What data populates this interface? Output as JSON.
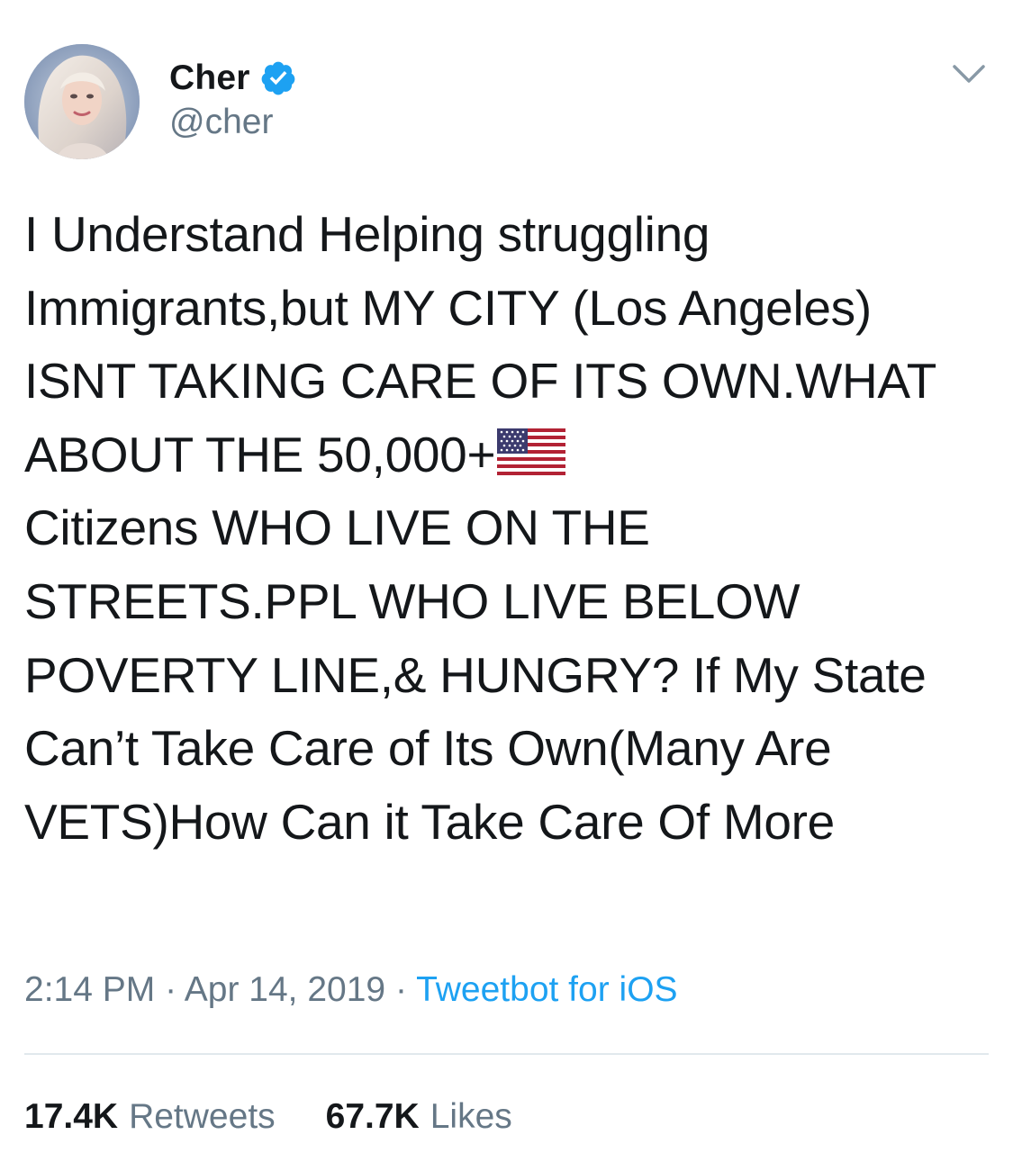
{
  "author": {
    "display_name": "Cher",
    "handle": "@cher",
    "verified": true
  },
  "tweet": {
    "text_before_flag": "I Understand Helping struggling Immigrants,but MY CITY (Los Angeles) ISNT TAKING CARE OF ITS OWN.WHAT ABOUT THE 50,000+",
    "flag_emoji": "🇺🇸",
    "text_after_flag": "\nCitizens WHO LIVE ON THE STREETS.PPL WHO LIVE BELOW POVERTY LINE,& HUNGRY? If My State Can’t Take Care of Its Own(Many Are VETS)How Can it Take Care Of More"
  },
  "meta": {
    "time": "2:14 PM",
    "separator": " · ",
    "date": "Apr 14, 2019",
    "source": "Tweetbot for iOS"
  },
  "stats": {
    "retweets_count": "17.4K",
    "retweets_label": "Retweets",
    "likes_count": "67.7K",
    "likes_label": "Likes"
  },
  "icons": {
    "verified": "verified-badge-icon",
    "menu": "chevron-down-icon",
    "flag": "us-flag-icon"
  },
  "colors": {
    "text": "#14171a",
    "secondary": "#657786",
    "link": "#1da1f2",
    "verified": "#1da1f2",
    "divider": "#e1e8ed"
  }
}
